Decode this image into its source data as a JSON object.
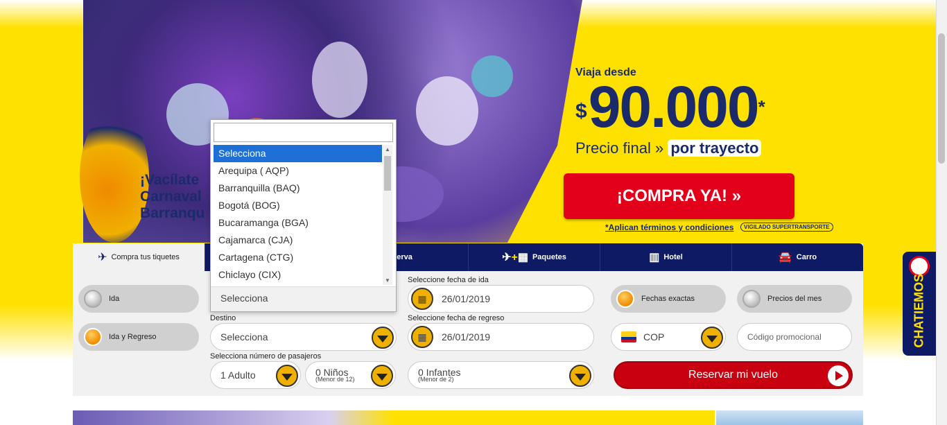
{
  "hero": {
    "headline_line1": "¡Vacílate",
    "headline_line2": "Carnaval",
    "headline_line3": "Barranqu"
  },
  "offer": {
    "from": "Viaja desde",
    "currency": "$",
    "price": "90.000",
    "asterisk": "*",
    "final_prefix": "Precio final »",
    "final_highlight": "por trayecto",
    "buy_label": "¡COMPRA YA!  »",
    "terms": "*Aplican términos y condiciones",
    "vigilado": "VIGILADO SUPERTRANSPORTE"
  },
  "tabs": [
    {
      "label": "Compra tus tiquetes",
      "icon": "plane-icon"
    },
    {
      "label": "",
      "icon": ""
    },
    {
      "label": "serva",
      "icon": ""
    },
    {
      "label": "Paquetes",
      "icon": "plane-hotel-icon"
    },
    {
      "label": "Hotel",
      "icon": "building-icon"
    },
    {
      "label": "Carro",
      "icon": "car-icon"
    }
  ],
  "trip_type": {
    "one_way": "Ida",
    "round_trip": "Ida y Regreso"
  },
  "origin": {
    "current": "Selecciona",
    "options": [
      "Selecciona",
      "Arequipa ( AQP)",
      "Barranquilla (BAQ)",
      "Bogotá (BOG)",
      "Bucaramanga (BGA)",
      "Cajamarca (CJA)",
      "Cartagena (CTG)",
      "Chiclayo (CIX)"
    ]
  },
  "destination": {
    "label": "Destino",
    "value": "Selecciona"
  },
  "passengers": {
    "label": "Selecciona número de pasajeros",
    "adults": "1 Adulto",
    "children": "0 Niños",
    "children_sub": "(Menor de 12)",
    "infants": "0 Infantes",
    "infants_sub": "(Menor de 2)"
  },
  "dates": {
    "depart_label": "Seleccione fecha de ida",
    "depart_value": "26/01/2019",
    "return_label": "Seleccione fecha de regreso",
    "return_value": "26/01/2019"
  },
  "options": {
    "exact_dates": "Fechas exactas",
    "month_prices": "Precios del mes",
    "currency": "COP",
    "promo_placeholder": "Código promocional"
  },
  "reserve_label": "Reservar mi vuelo",
  "chat_label": "CHATIEMOS",
  "colors": {
    "brand_yellow": "#ffe100",
    "brand_navy": "#0e1a63",
    "brand_red": "#e2001a",
    "select_blue": "#1e70d6"
  }
}
